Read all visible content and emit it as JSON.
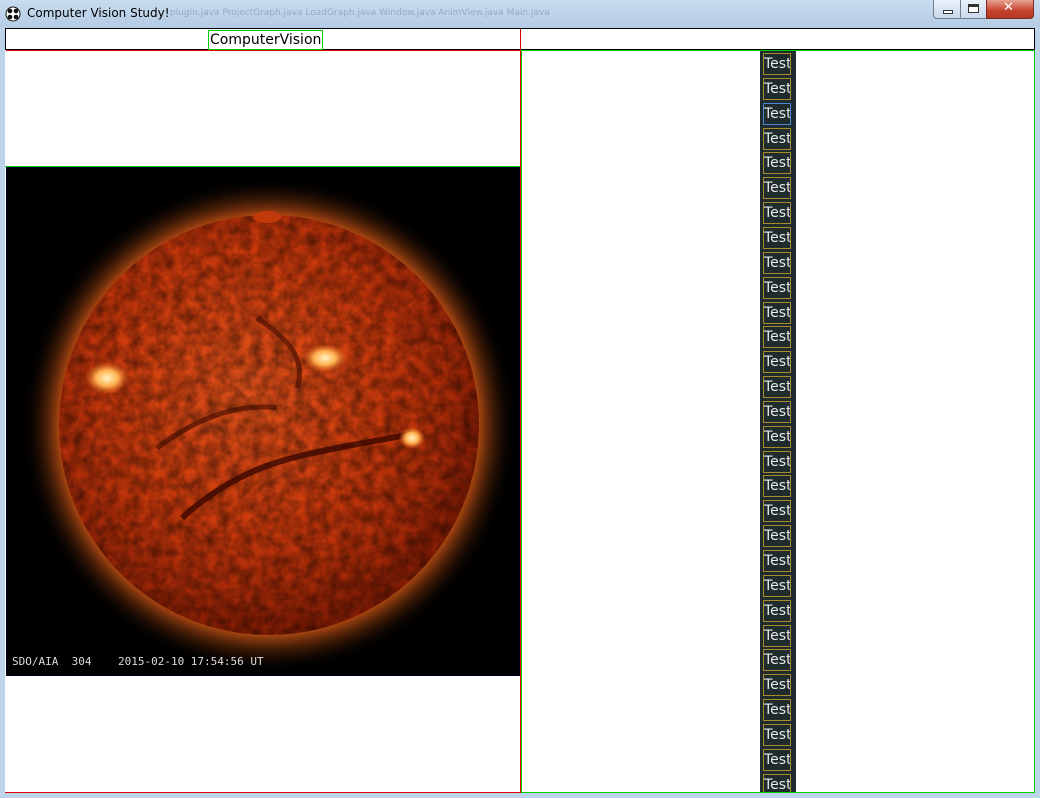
{
  "window": {
    "title": "Computer Vision Study!",
    "background_tabs": "plugin.java   ProjectGraph.java   LoadGraph.java   Window.java   AnimView.java   Main.java"
  },
  "header": {
    "title": "ComputerVision"
  },
  "image": {
    "caption": "SDO/AIA  304    2015-02-10 17:54:56 UT"
  },
  "list": {
    "items": [
      "Test",
      "Test",
      "Test",
      "Test",
      "Test",
      "Test",
      "Test",
      "Test",
      "Test",
      "Test",
      "Test",
      "Test",
      "Test",
      "Test",
      "Test",
      "Test",
      "Test",
      "Test",
      "Test",
      "Test",
      "Test",
      "Test",
      "Test",
      "Test",
      "Test",
      "Test",
      "Test",
      "Test",
      "Test",
      "Test"
    ],
    "focused_index": 2
  },
  "colors": {
    "panel_border": "#dd0000",
    "item_border": "#00cc00",
    "list_background": "#1f2b2d"
  }
}
